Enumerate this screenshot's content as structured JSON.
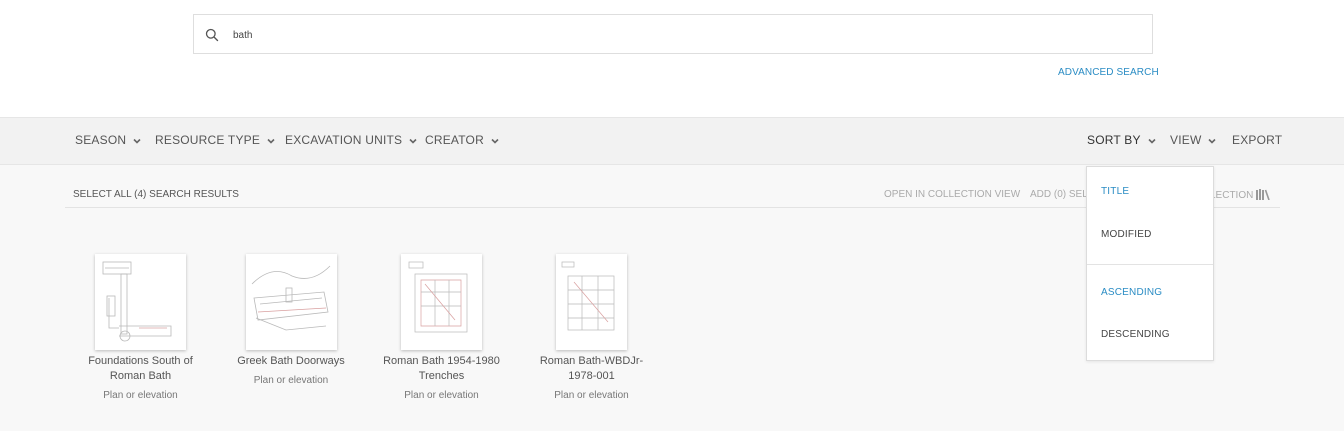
{
  "search": {
    "value": "bath",
    "advanced_label": "ADVANCED SEARCH"
  },
  "filters": [
    {
      "label": "SEASON"
    },
    {
      "label": "RESOURCE TYPE"
    },
    {
      "label": "EXCAVATION UNITS"
    },
    {
      "label": "CREATOR"
    }
  ],
  "toolbar_right": {
    "sort_label": "SORT BY",
    "view_label": "VIEW",
    "export_label": "EXPORT"
  },
  "results_bar": {
    "select_all": "SELECT ALL (4) SEARCH RESULTS",
    "open_collection": "OPEN IN COLLECTION VIEW",
    "add_selected": "ADD (0) SEL",
    "collection_partial": "LECTION"
  },
  "results": [
    {
      "title": "Foundations South of Roman Bath",
      "type": "Plan or elevation"
    },
    {
      "title": "Greek Bath Doorways",
      "type": "Plan or elevation"
    },
    {
      "title": "Roman Bath 1954-1980 Trenches",
      "type": "Plan or elevation"
    },
    {
      "title": "Roman Bath-WBDJr-1978-001",
      "type": "Plan or elevation"
    }
  ],
  "sort_menu": {
    "fields": [
      "TITLE",
      "MODIFIED"
    ],
    "orders": [
      "ASCENDING",
      "DESCENDING"
    ],
    "active_field": "TITLE",
    "active_order": "ASCENDING"
  },
  "colors": {
    "accent": "#2a8cc4",
    "bar_bg": "#f2f2f2",
    "content_bg": "#f8f8f8"
  },
  "icons": {
    "search": "search-icon",
    "chevron": "chevron-down-icon",
    "collection": "library-books-icon"
  }
}
